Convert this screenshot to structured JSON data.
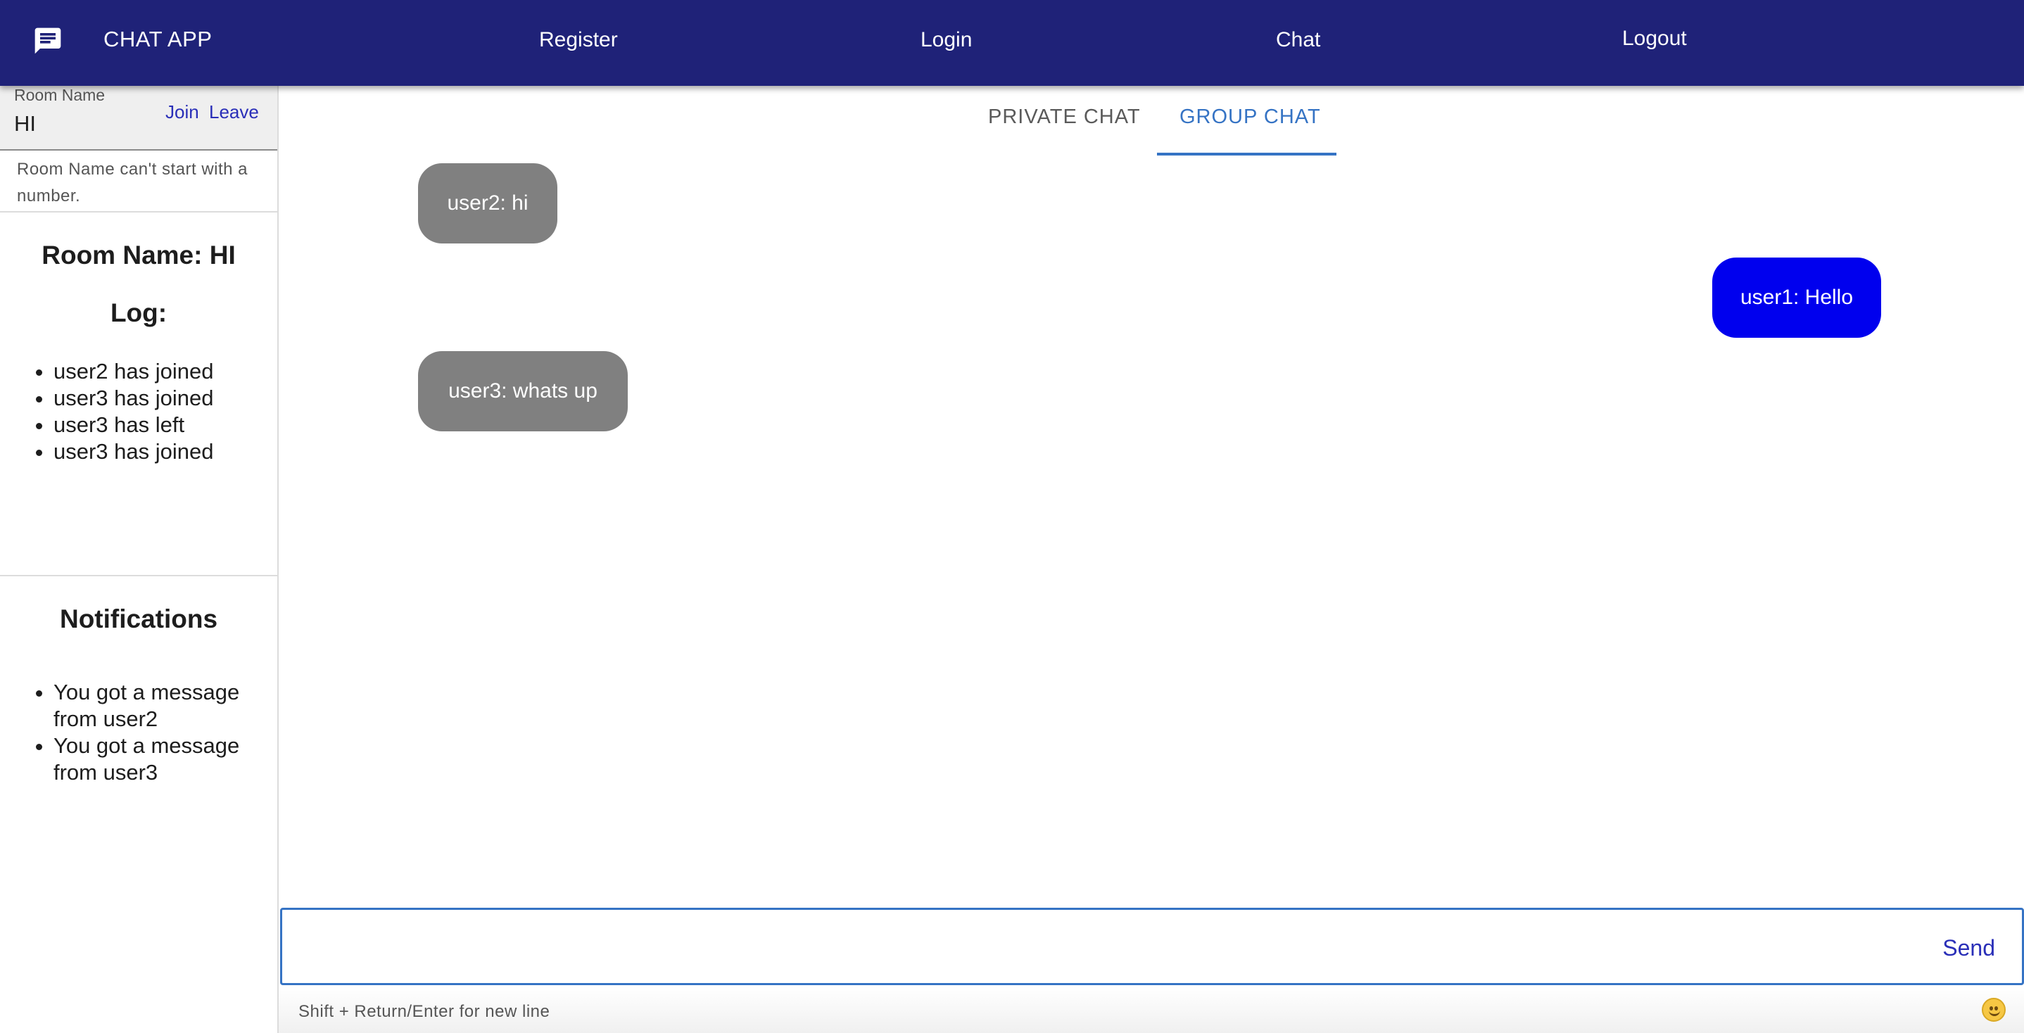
{
  "app": {
    "title": "CHAT APP",
    "logo_icon": "chat-bubble-icon"
  },
  "nav": {
    "register": "Register",
    "login": "Login",
    "chat": "Chat",
    "logout": "Logout"
  },
  "room": {
    "label": "Room Name",
    "value": "HI",
    "join": "Join",
    "leave": "Leave",
    "helper": "Room Name can't start with a number."
  },
  "sidebar": {
    "room_heading": "Room Name: HI",
    "log_heading": "Log:",
    "log": [
      "user2 has joined",
      "user3 has joined",
      "user3 has left",
      "user3 has joined"
    ],
    "notifications_heading": "Notifications",
    "notifications": [
      "You got a message from user2",
      "You got a message from user3"
    ]
  },
  "tabs": {
    "private": "PRIVATE CHAT",
    "group": "GROUP CHAT",
    "active": "group"
  },
  "messages": [
    {
      "text": "user2: hi",
      "side": "left"
    },
    {
      "text": "user1: Hello",
      "side": "right"
    },
    {
      "text": "user3: whats up",
      "side": "left"
    }
  ],
  "composer": {
    "value": "",
    "send": "Send",
    "hint": "Shift + Return/Enter for new line",
    "emoji_icon": "smiley-icon"
  },
  "colors": {
    "appbar": "#1f2278",
    "accent": "#3573c4",
    "own_bubble": "#0000ee",
    "other_bubble": "#808080"
  }
}
